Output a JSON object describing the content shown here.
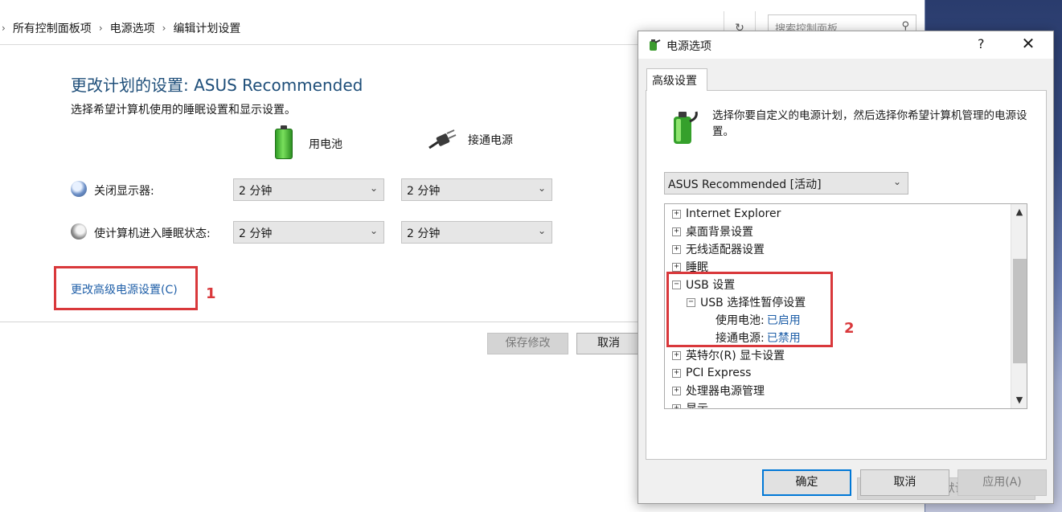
{
  "address_bar": {
    "breadcrumb": [
      "所有控制面板项",
      "电源选项",
      "编辑计划设置"
    ],
    "search_placeholder": "搜索控制面板"
  },
  "page": {
    "title": "更改计划的设置: ASUS Recommended",
    "subtitle": "选择希望计算机使用的睡眠设置和显示设置。",
    "columns": {
      "battery": "用电池",
      "plugged_in": "接通电源"
    },
    "rows": [
      {
        "label": "关闭显示器:",
        "battery_value": "2 分钟",
        "plugged_value": "2 分钟",
        "icon": "monitor-icon"
      },
      {
        "label": "使计算机进入睡眠状态:",
        "battery_value": "2 分钟",
        "plugged_value": "2 分钟",
        "icon": "moon-icon"
      }
    ],
    "advanced_link": "更改高级电源设置(C)",
    "save_button": "保存修改",
    "cancel_button": "取消"
  },
  "annotations": {
    "marker_1": "1",
    "marker_2": "2",
    "highlight_color": "#d9383b"
  },
  "dialog": {
    "title": "电源选项",
    "help": "?",
    "close": "✕",
    "tab": "高级设置",
    "description": "选择你要自定义的电源计划，然后选择你希望计算机管理的电源设置。",
    "plan_selected": "ASUS Recommended [活动]",
    "tree": [
      {
        "expander": "+",
        "label": "Internet Explorer",
        "level": 0
      },
      {
        "expander": "+",
        "label": "桌面背景设置",
        "level": 0
      },
      {
        "expander": "+",
        "label": "无线适配器设置",
        "level": 0
      },
      {
        "expander": "+",
        "label": "睡眠",
        "level": 0
      },
      {
        "expander": "−",
        "label": "USB 设置",
        "level": 0
      },
      {
        "expander": "−",
        "label": "USB 选择性暂停设置",
        "level": 1
      },
      {
        "expander": "",
        "label": "使用电池:",
        "value": "已启用",
        "level": 2
      },
      {
        "expander": "",
        "label": "接通电源:",
        "value": "已禁用",
        "level": 2
      },
      {
        "expander": "+",
        "label": "英特尔(R) 显卡设置",
        "level": 0
      },
      {
        "expander": "+",
        "label": "PCI Express",
        "level": 0
      },
      {
        "expander": "+",
        "label": "处理器电源管理",
        "level": 0
      },
      {
        "expander": "+",
        "label": "显示",
        "level": 0
      }
    ],
    "restore_button": "还原计划默认值(R)",
    "ok_button": "确定",
    "cancel_button": "取消",
    "apply_button": "应用(A)"
  }
}
